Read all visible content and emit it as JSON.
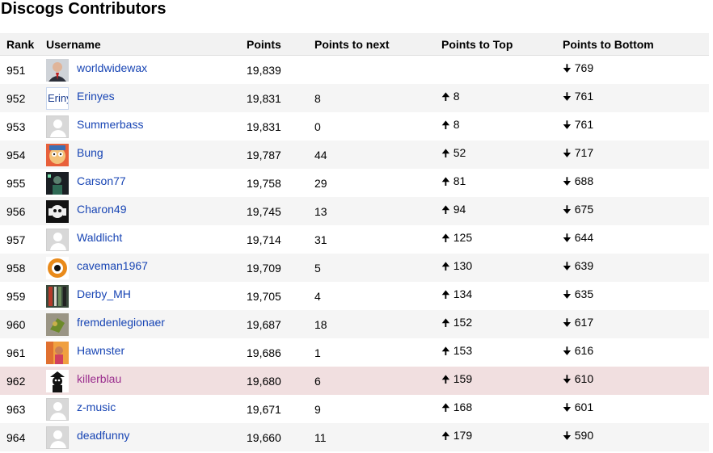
{
  "title": "Discogs Contributors",
  "columns": {
    "rank": "Rank",
    "username": "Username",
    "points": "Points",
    "next": "Points to next",
    "top": "Points to Top",
    "bottom": "Points to Bottom"
  },
  "arrows": {
    "up": "🠉",
    "down": "🠋"
  },
  "rows": [
    {
      "rank": "951",
      "user": "worldwidewax",
      "points": "19,839",
      "next": "",
      "top": "",
      "bottom": "769",
      "avatar": "photo-man-suit"
    },
    {
      "rank": "952",
      "user": "Erinyes",
      "points": "19,831",
      "next": "8",
      "top": "8",
      "bottom": "761",
      "avatar": "text-logo",
      "avatar_text": "Eriny"
    },
    {
      "rank": "953",
      "user": "Summerbass",
      "points": "19,831",
      "next": "0",
      "top": "8",
      "bottom": "761",
      "avatar": "default-user"
    },
    {
      "rank": "954",
      "user": "Bung",
      "points": "19,787",
      "next": "44",
      "top": "52",
      "bottom": "717",
      "avatar": "cartoon-face"
    },
    {
      "rank": "955",
      "user": "Carson77",
      "points": "19,758",
      "next": "29",
      "top": "81",
      "bottom": "688",
      "avatar": "dark-figure"
    },
    {
      "rank": "956",
      "user": "Charon49",
      "points": "19,745",
      "next": "13",
      "top": "94",
      "bottom": "675",
      "avatar": "skull-headphones"
    },
    {
      "rank": "957",
      "user": "Waldlicht",
      "points": "19,714",
      "next": "31",
      "top": "125",
      "bottom": "644",
      "avatar": "default-user"
    },
    {
      "rank": "958",
      "user": "caveman1967",
      "points": "19,709",
      "next": "5",
      "top": "130",
      "bottom": "639",
      "avatar": "orange-record"
    },
    {
      "rank": "959",
      "user": "Derby_MH",
      "points": "19,705",
      "next": "4",
      "top": "134",
      "bottom": "635",
      "avatar": "shelf-photo"
    },
    {
      "rank": "960",
      "user": "fremdenlegionaer",
      "points": "19,687",
      "next": "18",
      "top": "152",
      "bottom": "617",
      "avatar": "green-figure"
    },
    {
      "rank": "961",
      "user": "Hawnster",
      "points": "19,686",
      "next": "1",
      "top": "153",
      "bottom": "616",
      "avatar": "colorful-photo"
    },
    {
      "rank": "962",
      "user": "killerblau",
      "points": "19,680",
      "next": "6",
      "top": "159",
      "bottom": "610",
      "avatar": "bw-character",
      "highlight": true
    },
    {
      "rank": "963",
      "user": "z-music",
      "points": "19,671",
      "next": "9",
      "top": "168",
      "bottom": "601",
      "avatar": "default-user"
    },
    {
      "rank": "964",
      "user": "deadfunny",
      "points": "19,660",
      "next": "11",
      "top": "179",
      "bottom": "590",
      "avatar": "default-user"
    }
  ]
}
